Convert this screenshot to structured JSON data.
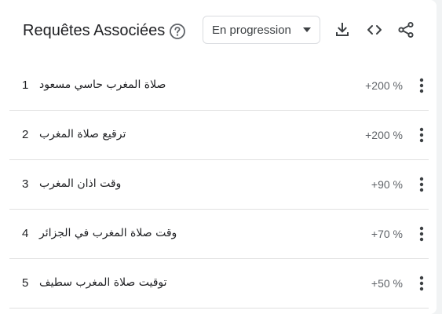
{
  "header": {
    "title": "Requêtes Associées",
    "help_icon": "help-circle-icon",
    "dropdown_selected": "En progression",
    "tools": [
      "download-icon",
      "embed-code-icon",
      "share-icon"
    ]
  },
  "colors": {
    "text_primary": "#202124",
    "text_secondary": "#5f6368",
    "divider": "#e0e0e0",
    "icon": "#3c4043"
  },
  "rows": [
    {
      "rank": "1",
      "query": "صلاة المغرب حاسي مسعود",
      "value": "+200 %"
    },
    {
      "rank": "2",
      "query": "ترقيع صلاة المغرب",
      "value": "+200 %"
    },
    {
      "rank": "3",
      "query": "وقت اذان المغرب",
      "value": "+90 %"
    },
    {
      "rank": "4",
      "query": "وقت صلاة المغرب في الجزائر",
      "value": "+70 %"
    },
    {
      "rank": "5",
      "query": "توقيت صلاة المغرب سطيف",
      "value": "+50 %"
    }
  ]
}
